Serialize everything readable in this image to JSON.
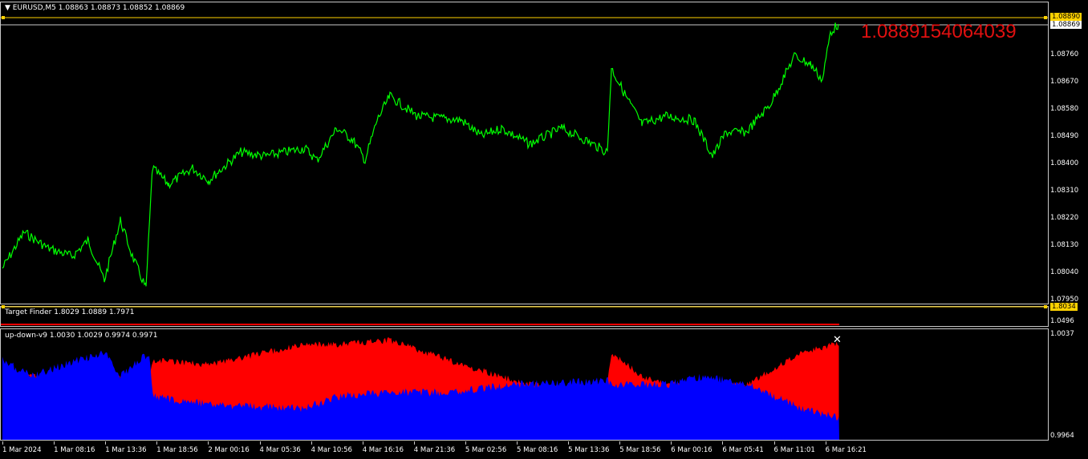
{
  "main": {
    "title": "EURUSD,M5  1.08863 1.08873 1.08852 1.08869",
    "big_price": "1.0889154064039",
    "price_ticks": [
      "1.08850",
      "1.08760",
      "1.08670",
      "1.08580",
      "1.08490",
      "1.08400",
      "1.08310",
      "1.08220",
      "1.08130",
      "1.08040",
      "1.07950"
    ],
    "tag_high": "1.08890",
    "tag_current": "1.08869",
    "colors": {
      "price_line": "#00ff00",
      "hline": "#ffd200"
    }
  },
  "target_finder": {
    "label": "Target Finder 1.8029 1.0889 1.7971",
    "tag": "1.8034",
    "tick": "1.0496"
  },
  "updown": {
    "label": "up-down-v9 1.0030 1.0029 0.9974 0.9971",
    "tick_top": "1.0037",
    "tick_bottom": "0.9964",
    "colors": {
      "up": "#0000ff",
      "down": "#ff0000"
    }
  },
  "time_axis": [
    "1 Mar 2024",
    "1 Mar 08:16",
    "1 Mar 13:36",
    "1 Mar 18:56",
    "2 Mar 00:16",
    "4 Mar 05:36",
    "4 Mar 10:56",
    "4 Mar 16:16",
    "4 Mar 21:36",
    "5 Mar 02:56",
    "5 Mar 08:16",
    "5 Mar 13:36",
    "5 Mar 18:56",
    "6 Mar 00:16",
    "6 Mar 05:41",
    "6 Mar 11:01",
    "6 Mar 16:21"
  ]
}
